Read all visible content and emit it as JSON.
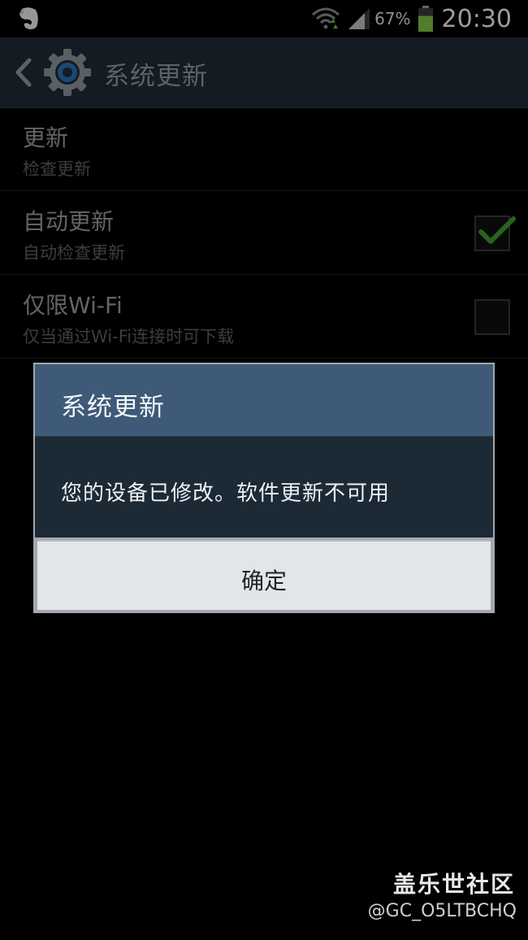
{
  "status_bar": {
    "battery_percent": "67%",
    "time": "20:30",
    "icons": [
      "evernote-icon",
      "wifi-icon",
      "signal-icon",
      "battery-icon"
    ],
    "battery_level": 0.67,
    "battery_color": "#7bc043"
  },
  "action_bar": {
    "title": "系统更新",
    "icons": [
      "back-arrow-icon",
      "settings-gear-icon"
    ]
  },
  "settings": [
    {
      "title": "更新",
      "subtitle": "检查更新"
    },
    {
      "title": "自动更新",
      "subtitle": "自动检查更新",
      "checked": true
    },
    {
      "title": "仅限Wi-Fi",
      "subtitle": "仅当通过Wi-Fi连接时可下载",
      "checked": false
    }
  ],
  "dialog": {
    "title": "系统更新",
    "message": "您的设备已修改。软件更新不可用",
    "ok_label": "确定"
  },
  "watermark": {
    "line1": "盖乐世社区",
    "line2": "@GC_O5LTBCHQ"
  },
  "colors": {
    "action_bar_bg": "#1f2a36",
    "dialog_header": "#3e5a78",
    "dialog_body": "#1c2a36",
    "check_green": "#3a9a2a"
  }
}
